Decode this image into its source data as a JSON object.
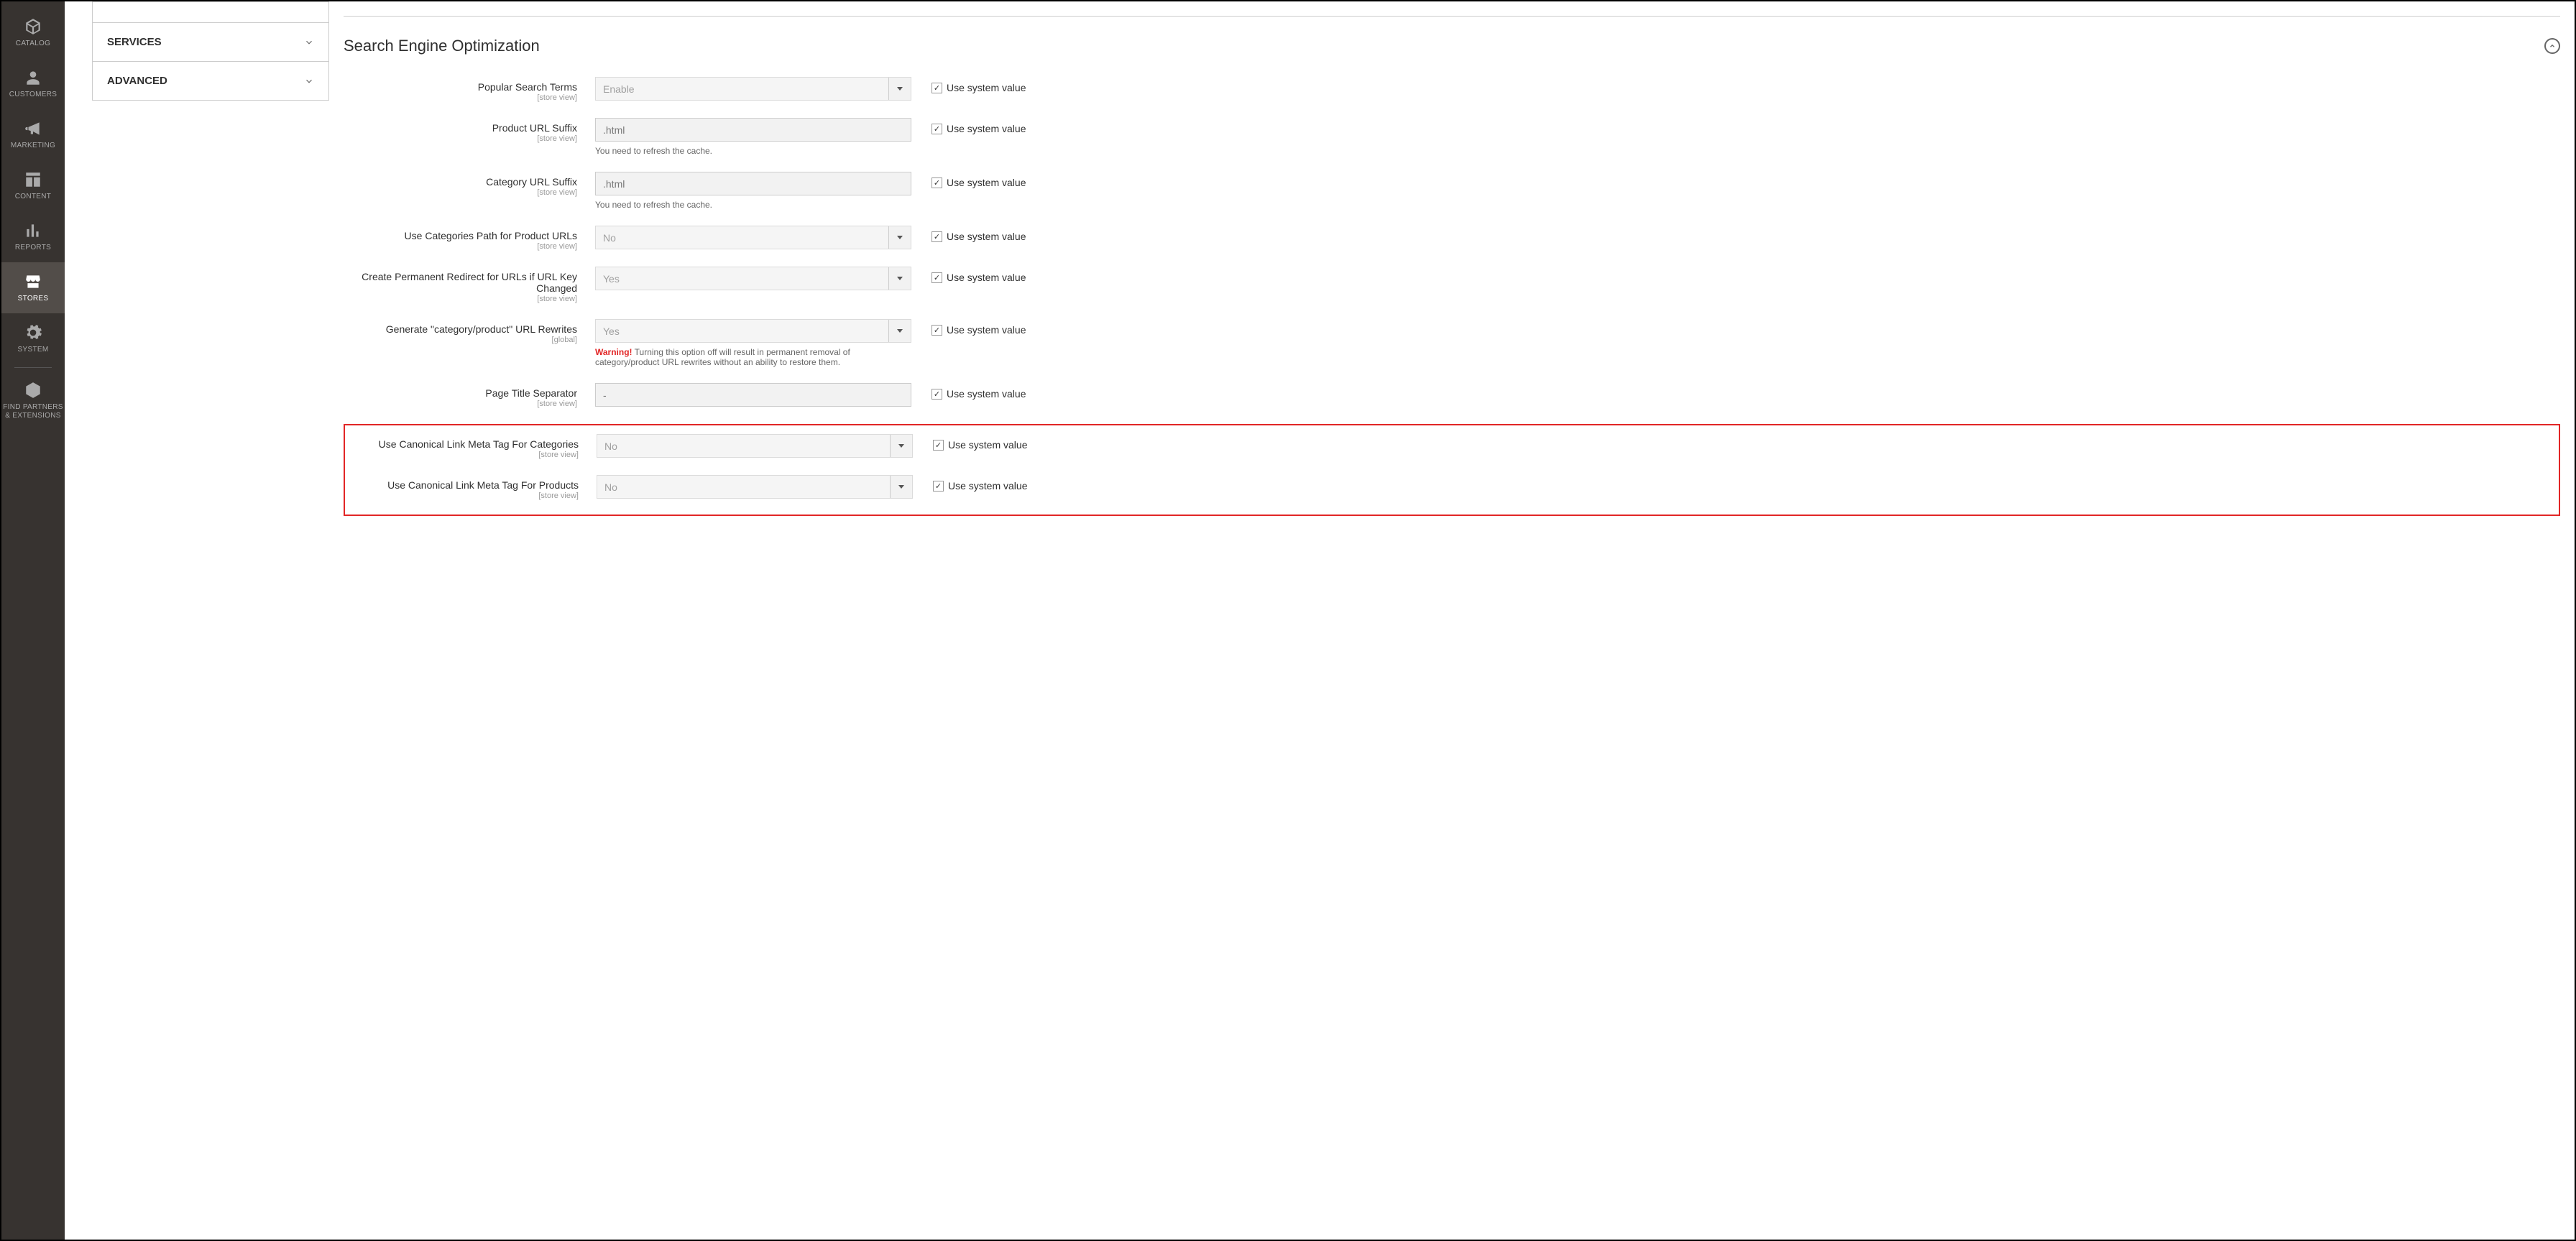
{
  "sidebar": {
    "items": [
      {
        "label": "CATALOG"
      },
      {
        "label": "CUSTOMERS"
      },
      {
        "label": "MARKETING"
      },
      {
        "label": "CONTENT"
      },
      {
        "label": "REPORTS"
      },
      {
        "label": "STORES"
      },
      {
        "label": "SYSTEM"
      },
      {
        "label": "FIND PARTNERS & EXTENSIONS"
      }
    ]
  },
  "config_nav": {
    "services": "SERVICES",
    "advanced": "ADVANCED"
  },
  "section": {
    "title": "Search Engine Optimization"
  },
  "scope": {
    "store_view": "[store view]",
    "global": "[global]"
  },
  "checkbox_label": "Use system value",
  "fields": {
    "popular_search": {
      "label": "Popular Search Terms",
      "value": "Enable"
    },
    "product_suffix": {
      "label": "Product URL Suffix",
      "value": ".html",
      "note": "You need to refresh the cache."
    },
    "category_suffix": {
      "label": "Category URL Suffix",
      "value": ".html",
      "note": "You need to refresh the cache."
    },
    "use_cat_path": {
      "label": "Use Categories Path for Product URLs",
      "value": "No"
    },
    "redirect": {
      "label": "Create Permanent Redirect for URLs if URL Key Changed",
      "value": "Yes"
    },
    "generate_rewrites": {
      "label": "Generate \"category/product\" URL Rewrites",
      "value": "Yes",
      "warn": "Warning!",
      "note": " Turning this option off will result in permanent removal of category/product URL rewrites without an ability to restore them."
    },
    "page_title_sep": {
      "label": "Page Title Separator",
      "value": "-"
    },
    "canonical_cat": {
      "label": "Use Canonical Link Meta Tag For Categories",
      "value": "No"
    },
    "canonical_prod": {
      "label": "Use Canonical Link Meta Tag For Products",
      "value": "No"
    }
  }
}
